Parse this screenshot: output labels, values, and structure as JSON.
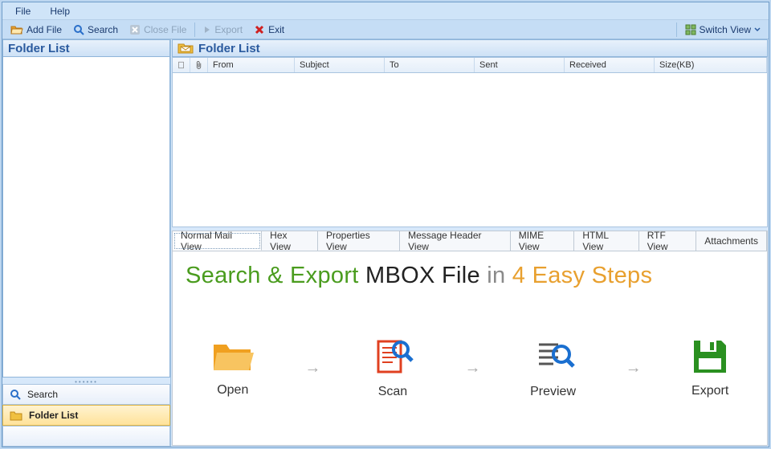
{
  "menu": {
    "file": "File",
    "help": "Help"
  },
  "toolbar": {
    "addFile": "Add File",
    "search": "Search",
    "closeFile": "Close File",
    "export": "Export",
    "exit": "Exit",
    "switchView": "Switch View"
  },
  "sidebar": {
    "header": "Folder List",
    "nav": {
      "search": "Search",
      "folderList": "Folder List"
    }
  },
  "content": {
    "header": "Folder List",
    "columns": {
      "from": "From",
      "subject": "Subject",
      "to": "To",
      "sent": "Sent",
      "received": "Received",
      "size": "Size(KB)"
    }
  },
  "tabs": {
    "normal": "Normal Mail View",
    "hex": "Hex View",
    "properties": "Properties View",
    "header": "Message Header View",
    "mime": "MIME View",
    "html": "HTML View",
    "rtf": "RTF View",
    "attachments": "Attachments"
  },
  "promo": {
    "t1": "Search & Export",
    "t2": "MBOX File",
    "t3": "in",
    "t4": "4 Easy Steps",
    "steps": {
      "open": "Open",
      "scan": "Scan",
      "preview": "Preview",
      "export": "Export"
    }
  }
}
